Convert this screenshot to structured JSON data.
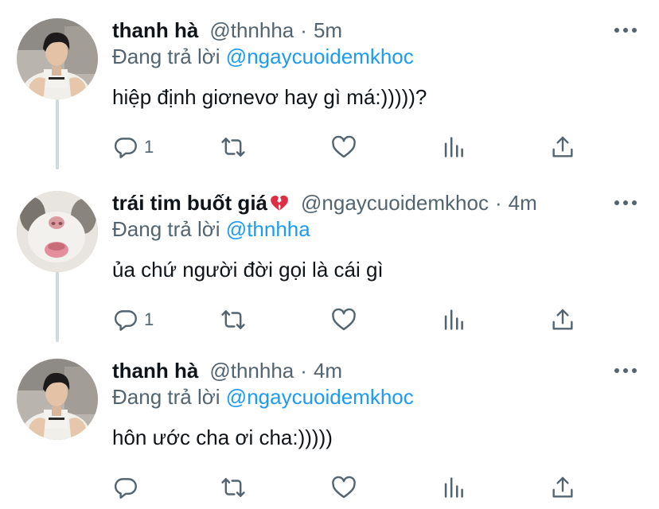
{
  "colors": {
    "link": "#1d9bf0",
    "secondary_text": "#536471",
    "primary_text": "#0f1419",
    "icon": "#536471",
    "thread_line": "#cfd9de"
  },
  "tweets": [
    {
      "avatar_icon": "avatar-boy-photo",
      "name": "thanh hà",
      "emoji": "",
      "handle": "@thnhha",
      "separator": "·",
      "time": "5m",
      "replying_prefix": "Đang trả lời",
      "replying_to": "@ngaycuoidemkhoc",
      "text": "hiệp định giơnevơ hay gì má:)))))?",
      "reply_count": "1"
    },
    {
      "avatar_icon": "avatar-cat-photo",
      "name": "trái tim buốt giá",
      "emoji": "broken-heart-icon",
      "handle": "@ngaycuoidemkhoc",
      "separator": "·",
      "time": "4m",
      "replying_prefix": "Đang trả lời",
      "replying_to": "@thnhha",
      "text": "ủa chứ người đời gọi là cái gì",
      "reply_count": "1"
    },
    {
      "avatar_icon": "avatar-boy-photo",
      "name": "thanh hà",
      "emoji": "",
      "handle": "@thnhha",
      "separator": "·",
      "time": "4m",
      "replying_prefix": "Đang trả lời",
      "replying_to": "@ngaycuoidemkhoc",
      "text": "hôn ước cha ơi cha:)))))",
      "reply_count": ""
    }
  ],
  "action_icons": [
    "reply-icon",
    "retweet-icon",
    "like-icon",
    "analytics-icon",
    "share-icon"
  ]
}
